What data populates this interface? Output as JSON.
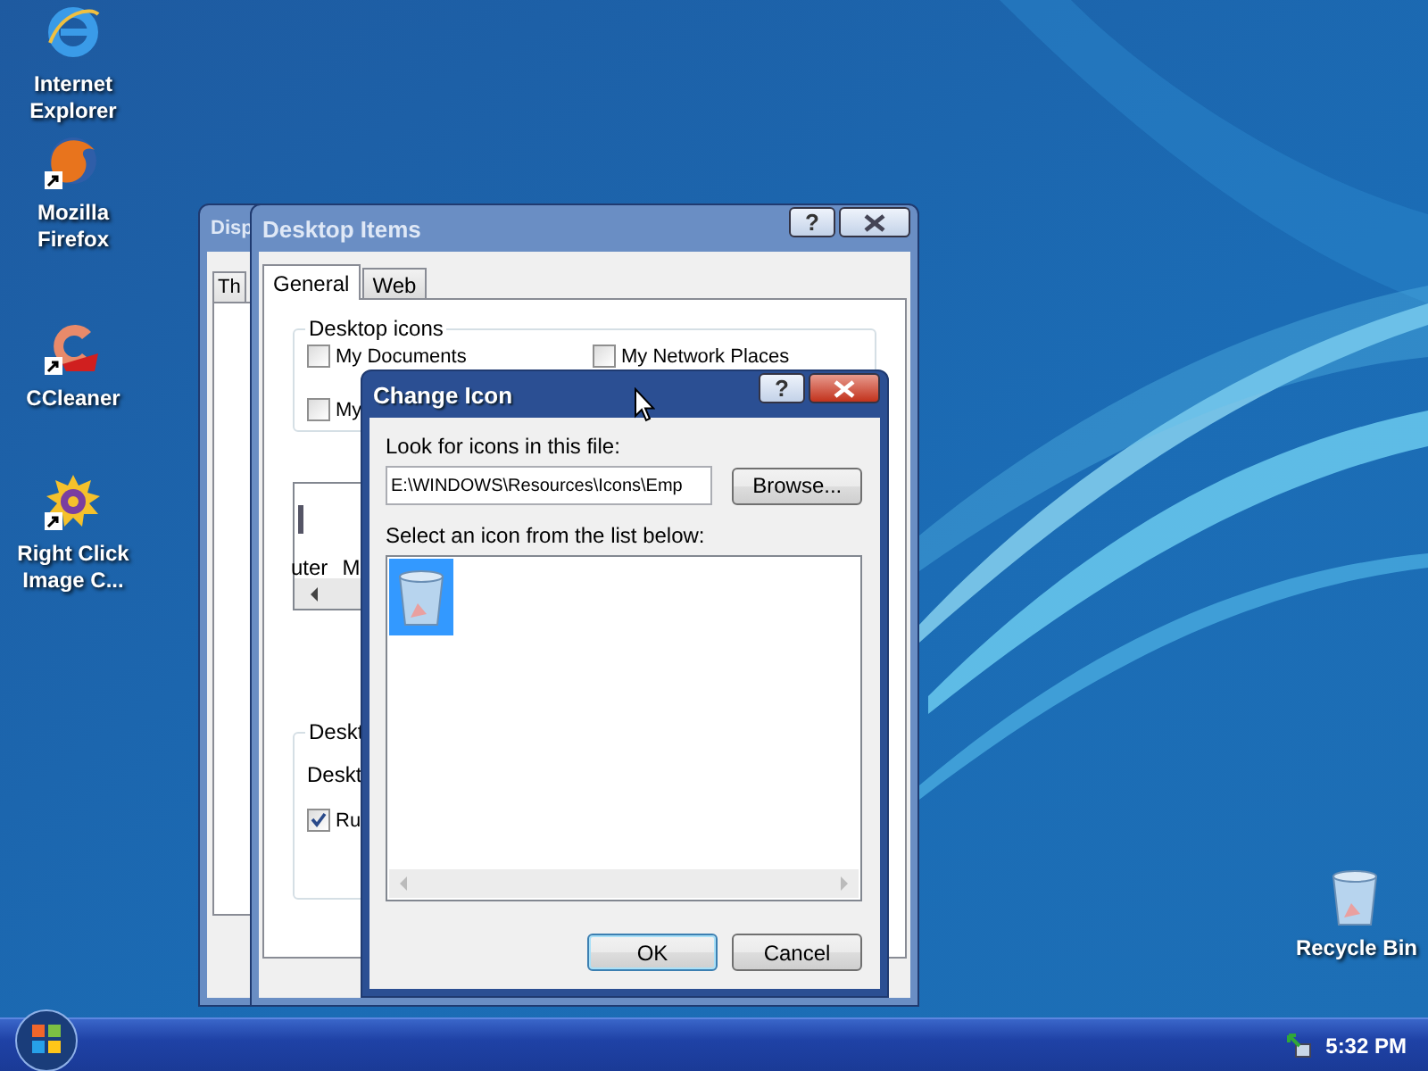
{
  "desktop_icons": [
    {
      "kind": "browser-e",
      "label": "Internet Explorer",
      "shortcut": false
    },
    {
      "kind": "fox",
      "label": "Mozilla Firefox",
      "shortcut": true
    },
    {
      "kind": "c-logo",
      "label": "CCleaner",
      "shortcut": true
    },
    {
      "kind": "gear",
      "label": "Right Click Image C...",
      "shortcut": true
    }
  ],
  "recycle_bin": {
    "label": "Recycle Bin"
  },
  "display_properties_window": {
    "title": "Disp",
    "tabs": [
      {
        "label": "Th",
        "selected": true
      }
    ]
  },
  "desktop_items_window": {
    "title": "Desktop Items",
    "help_button": "?",
    "tabs": [
      {
        "label": "General",
        "selected": true
      },
      {
        "label": "Web",
        "selected": false
      }
    ],
    "desktop_icons_group": {
      "title": "Desktop icons",
      "checkboxes": [
        {
          "label": "My Documents",
          "checked": false
        },
        {
          "label": "My",
          "checked": false
        },
        {
          "label": "My Network Places",
          "checked": false
        }
      ]
    },
    "icon_list": {
      "items": [
        "uter",
        "M"
      ]
    },
    "cleanup_group": {
      "title": "Deskt",
      "label": "Deskt",
      "checkbox": {
        "label": "Ru",
        "checked": true
      }
    }
  },
  "change_icon_dialog": {
    "title": "Change Icon",
    "help_button": "?",
    "file_label": "Look for icons in this file:",
    "file_value": "E:\\WINDOWS\\Resources\\Icons\\Emp",
    "browse_button": "Browse...",
    "list_label": "Select an icon from the list below:",
    "icons": [
      {
        "kind": "recycle-bin",
        "selected": true
      }
    ],
    "buttons": [
      {
        "label": "OK",
        "default": true
      },
      {
        "label": "Cancel",
        "default": false
      }
    ]
  },
  "taskbar": {
    "clock": "5:32 PM"
  }
}
